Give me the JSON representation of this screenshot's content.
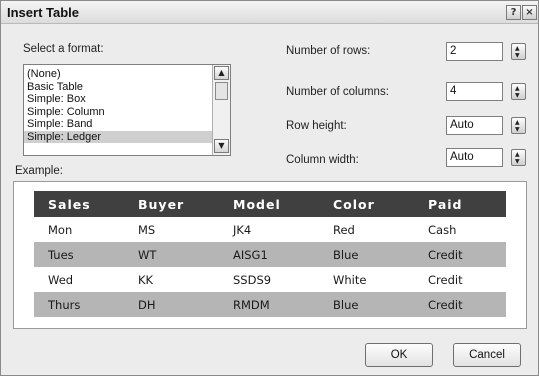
{
  "window": {
    "title": "Insert Table",
    "help_glyph": "?",
    "close_glyph": "×"
  },
  "format": {
    "label": "Select a format:",
    "items": [
      {
        "label": "(None)",
        "selected": false
      },
      {
        "label": "Basic Table",
        "selected": false
      },
      {
        "label": "Simple: Box",
        "selected": false
      },
      {
        "label": "Simple: Column",
        "selected": false
      },
      {
        "label": "Simple: Band",
        "selected": false
      },
      {
        "label": "Simple: Ledger",
        "selected": true
      }
    ],
    "scroll_up_glyph": "▲",
    "scroll_down_glyph": "▼"
  },
  "fields": {
    "rows": {
      "label": "Number of rows:",
      "value": "2"
    },
    "columns": {
      "label": "Number of columns:",
      "value": "4"
    },
    "row_height": {
      "label": "Row height:",
      "value": "Auto"
    },
    "column_width": {
      "label": "Column width:",
      "value": "Auto"
    }
  },
  "example": {
    "label": "Example:",
    "headers": [
      "Sales",
      "Buyer",
      "Model",
      "Color",
      "Paid"
    ],
    "rows": [
      [
        "Mon",
        "MS",
        "JK4",
        "Red",
        "Cash"
      ],
      [
        "Tues",
        "WT",
        "AISG1",
        "Blue",
        "Credit"
      ],
      [
        "Wed",
        "KK",
        "SSDS9",
        "White",
        "Credit"
      ],
      [
        "Thurs",
        "DH",
        "RMDM",
        "Blue",
        "Credit"
      ]
    ]
  },
  "buttons": {
    "ok": "OK",
    "cancel": "Cancel"
  },
  "colors": {
    "header_bg": "#404040",
    "shaded_row": "#b5b5b5",
    "dialog_bg": "#ececec"
  }
}
